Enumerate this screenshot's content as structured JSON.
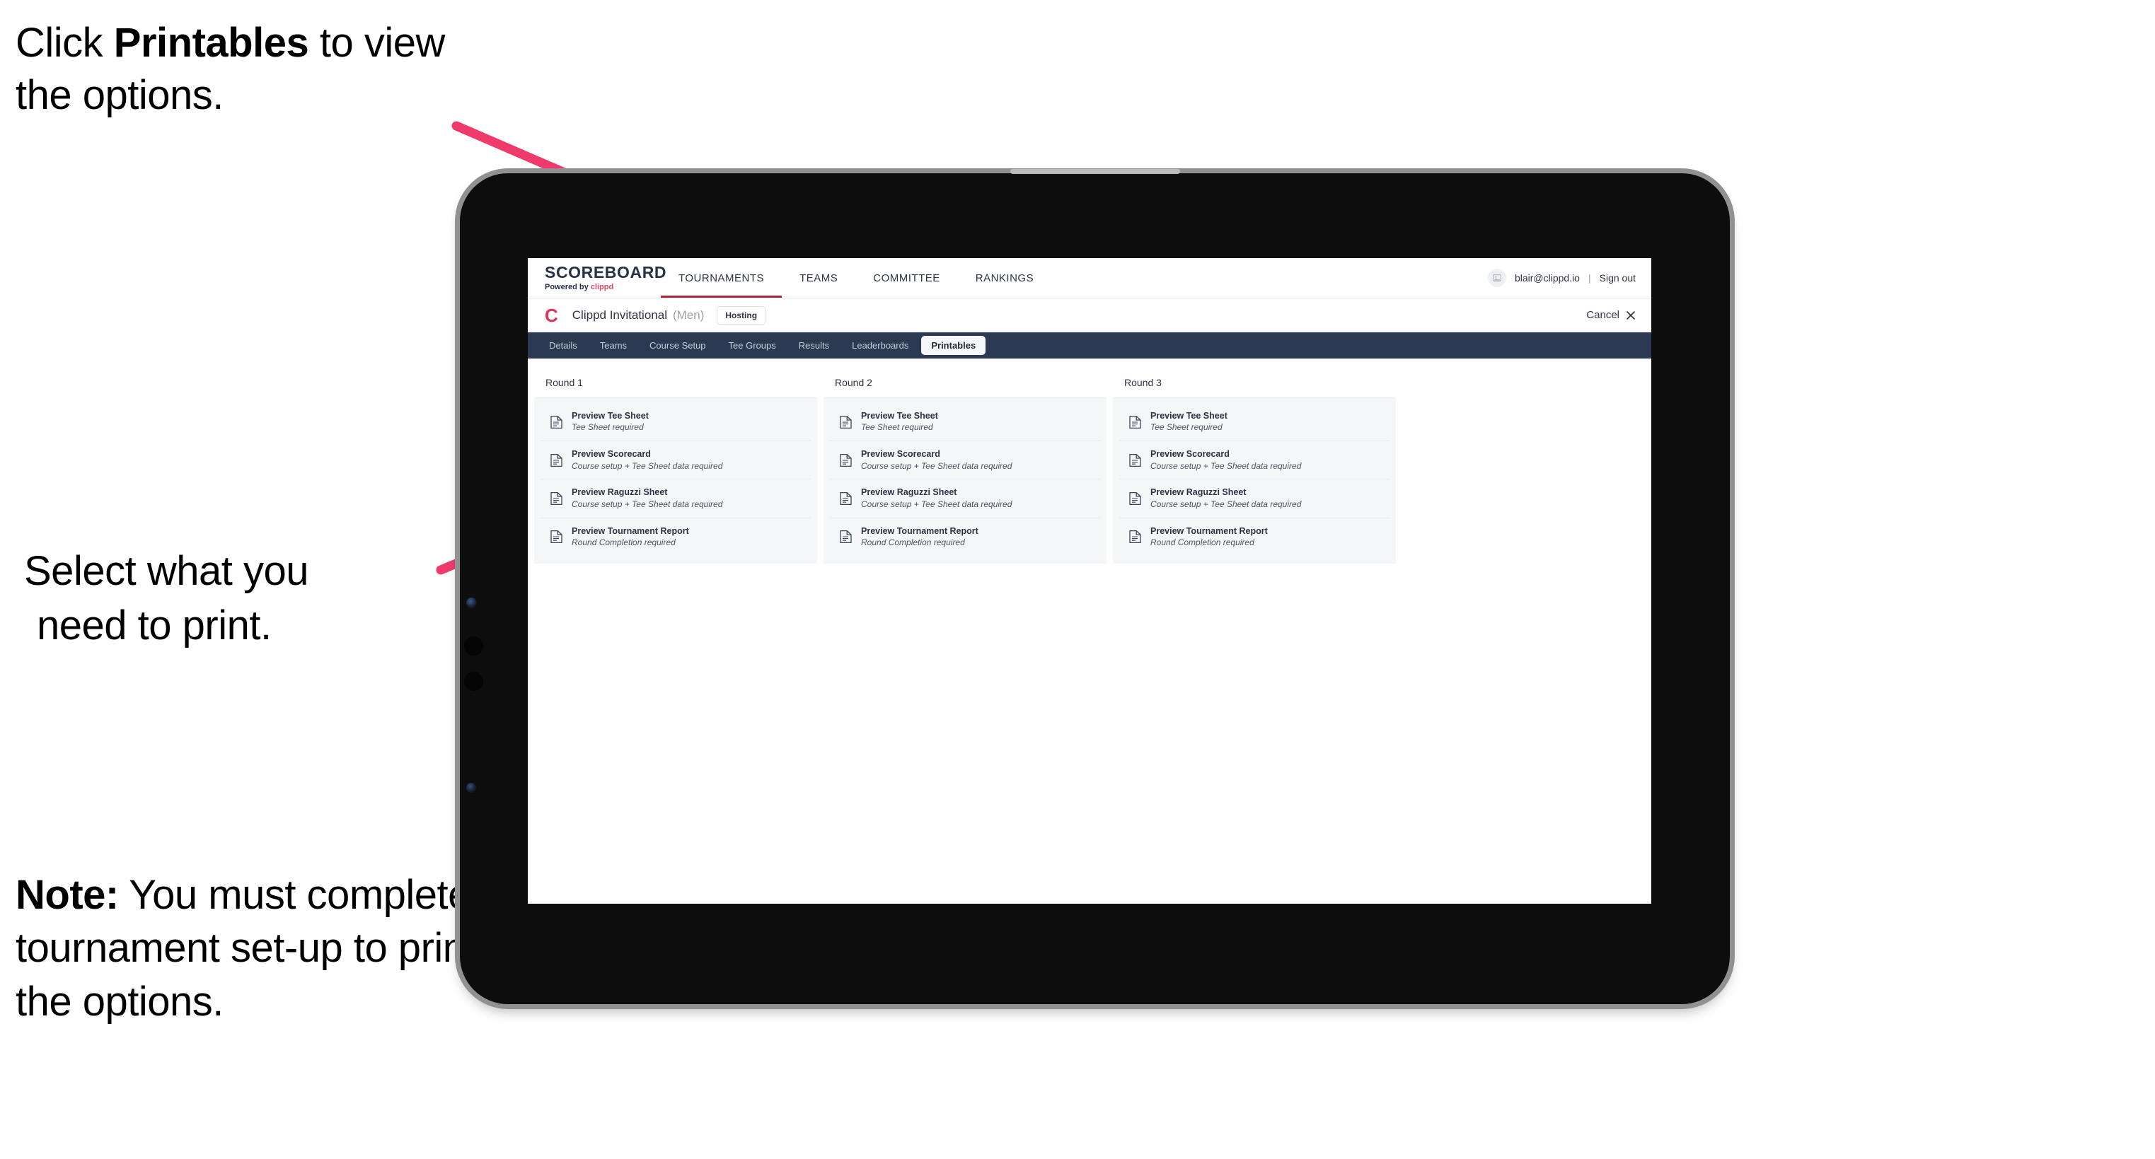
{
  "annotations": {
    "top": {
      "prefix": "Click ",
      "bold": "Printables",
      "suffix": " to view the options."
    },
    "middle": {
      "line1": "Select what you",
      "line2": "need to print."
    },
    "note": {
      "bold": "Note:",
      "text": " You must complete the tournament set-up to print all the options."
    },
    "arrow_color": "#ef3a6b"
  },
  "app": {
    "logo": {
      "word": "SCOREBOARD",
      "powered_by": "Powered by ",
      "brand": "clippd"
    },
    "topnav": [
      {
        "label": "TOURNAMENTS",
        "active": true
      },
      {
        "label": "TEAMS",
        "active": false
      },
      {
        "label": "COMMITTEE",
        "active": false
      },
      {
        "label": "RANKINGS",
        "active": false
      }
    ],
    "account": {
      "avatar_icon": "user-avatar-icon",
      "email": "blair@clippd.io",
      "separator": "|",
      "sign_out": "Sign out"
    },
    "tournament": {
      "logo_mark": "C",
      "name": "Clippd Invitational",
      "gender": "(Men)",
      "status_badge": "Hosting",
      "cancel_label": "Cancel",
      "cancel_icon": "close-icon"
    },
    "tabs": [
      {
        "label": "Details",
        "active": false
      },
      {
        "label": "Teams",
        "active": false
      },
      {
        "label": "Course Setup",
        "active": false
      },
      {
        "label": "Tee Groups",
        "active": false
      },
      {
        "label": "Results",
        "active": false
      },
      {
        "label": "Leaderboards",
        "active": false
      },
      {
        "label": "Printables",
        "active": true
      }
    ],
    "rounds": [
      {
        "title": "Round 1",
        "items": [
          {
            "title": "Preview Tee Sheet",
            "requirement": "Tee Sheet required",
            "icon": "document-icon"
          },
          {
            "title": "Preview Scorecard",
            "requirement": "Course setup + Tee Sheet data required",
            "icon": "document-icon"
          },
          {
            "title": "Preview Raguzzi Sheet",
            "requirement": "Course setup + Tee Sheet data required",
            "icon": "document-icon"
          },
          {
            "title": "Preview Tournament Report",
            "requirement": "Round Completion required",
            "icon": "document-icon"
          }
        ]
      },
      {
        "title": "Round 2",
        "items": [
          {
            "title": "Preview Tee Sheet",
            "requirement": "Tee Sheet required",
            "icon": "document-icon"
          },
          {
            "title": "Preview Scorecard",
            "requirement": "Course setup + Tee Sheet data required",
            "icon": "document-icon"
          },
          {
            "title": "Preview Raguzzi Sheet",
            "requirement": "Course setup + Tee Sheet data required",
            "icon": "document-icon"
          },
          {
            "title": "Preview Tournament Report",
            "requirement": "Round Completion required",
            "icon": "document-icon"
          }
        ]
      },
      {
        "title": "Round 3",
        "items": [
          {
            "title": "Preview Tee Sheet",
            "requirement": "Tee Sheet required",
            "icon": "document-icon"
          },
          {
            "title": "Preview Scorecard",
            "requirement": "Course setup + Tee Sheet data required",
            "icon": "document-icon"
          },
          {
            "title": "Preview Raguzzi Sheet",
            "requirement": "Course setup + Tee Sheet data required",
            "icon": "document-icon"
          },
          {
            "title": "Preview Tournament Report",
            "requirement": "Round Completion required",
            "icon": "document-icon"
          }
        ]
      }
    ],
    "colors": {
      "tabstrip_bg": "#2b3a52",
      "brand_pink": "#e0315b",
      "active_underline": "#a32638",
      "card_bg": "#f5f6f8"
    }
  }
}
